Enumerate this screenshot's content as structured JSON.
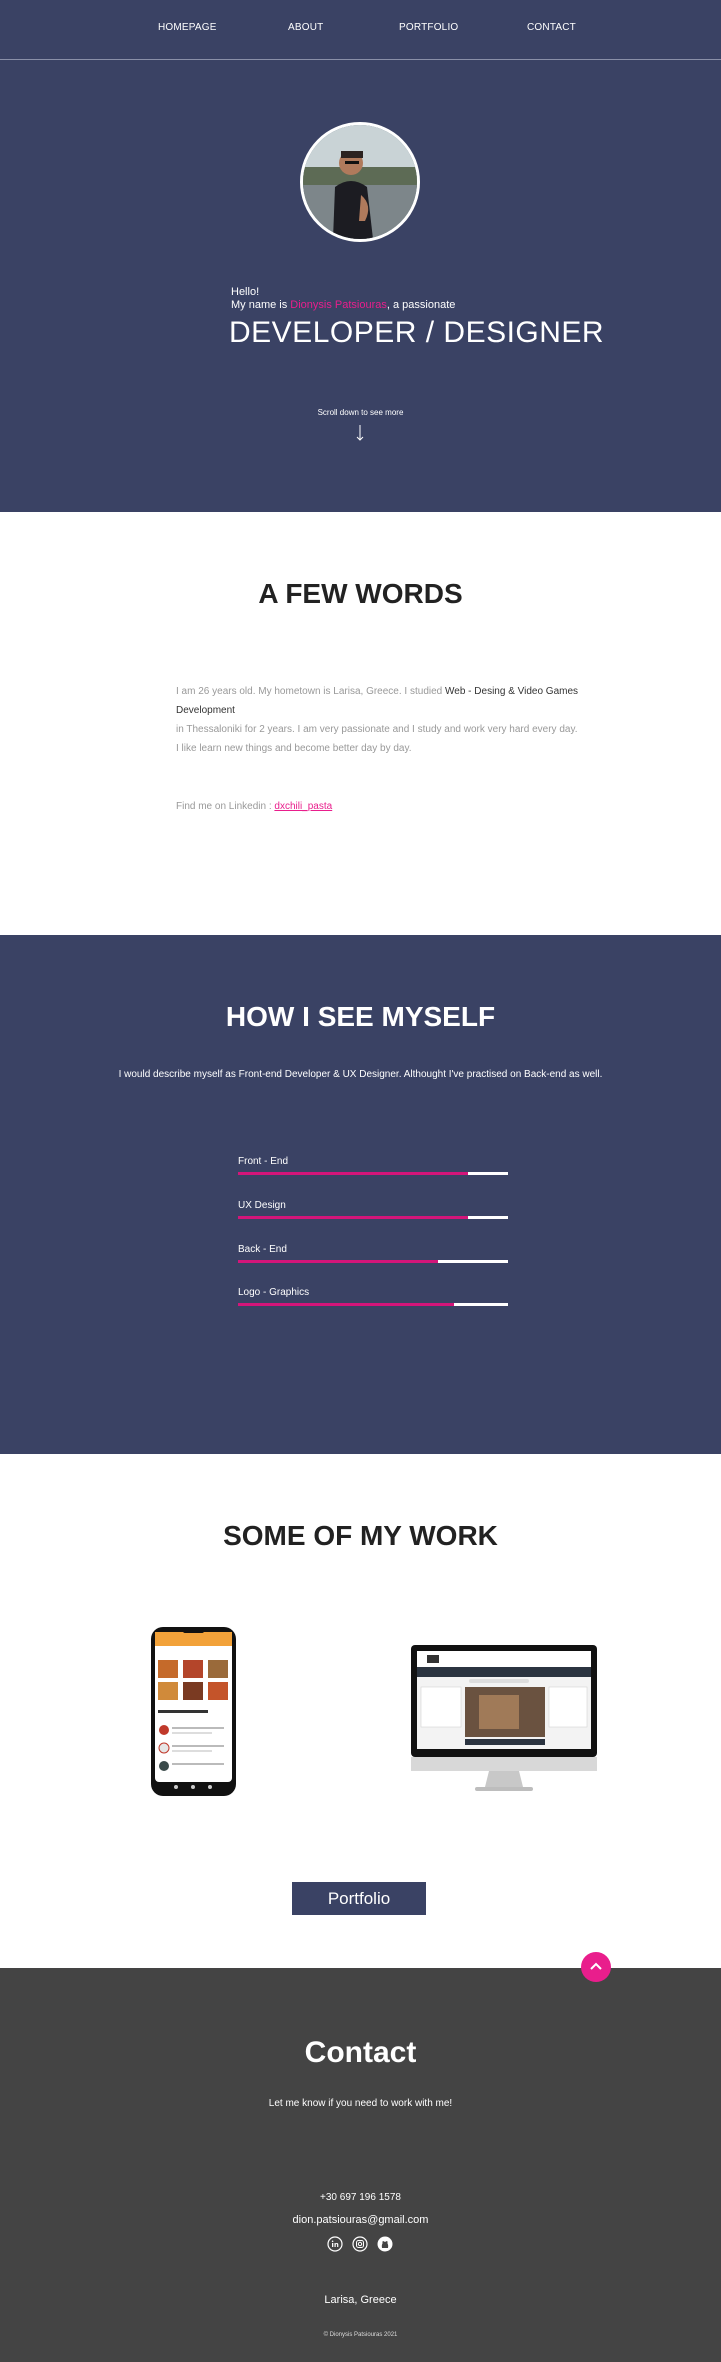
{
  "nav": {
    "items": [
      {
        "label": "HOMEPAGE"
      },
      {
        "label": "ABOUT"
      },
      {
        "label": "PORTFOLIO"
      },
      {
        "label": "CONTACT"
      }
    ]
  },
  "hero": {
    "hello": "Hello!",
    "name_prefix": "My name is ",
    "name": "Dionysis Patsiouras",
    "name_suffix": ", a passionate",
    "role": "DEVELOPER / DESIGNER",
    "scroll_hint": "Scroll down to see more"
  },
  "about": {
    "title": "A FEW WORDS",
    "line1_a": "I am 26 years old. My hometown is Larisa, Greece. I studied ",
    "line1_b": "Web - Desing & Video Games Development",
    "line2": "in Thessaloniki for 2 years. I am very passionate and I study and work very hard every day.",
    "line3": "I like learn new things and become better day by day.",
    "linkedin_label": "Find me on Linkedin : ",
    "linkedin_link": "dxchili_pasta"
  },
  "skills": {
    "title": "HOW I SEE MYSELF",
    "description": "I would describe myself as Front-end Developer & UX Designer. Althought I've practised on Back-end as well.",
    "items": [
      {
        "label": "Front - End",
        "level": 0.85
      },
      {
        "label": "UX Design",
        "level": 0.85
      },
      {
        "label": "Back - End",
        "level": 0.74
      },
      {
        "label": "Logo - Graphics",
        "level": 0.8
      }
    ],
    "fill_color": "#d4157a"
  },
  "work": {
    "title": "SOME OF MY WORK",
    "portfolio_button": "Portfolio"
  },
  "contact": {
    "title": "Contact",
    "subtitle": "Let me know if you need to work with me!",
    "phone": "+30 697 196 1578",
    "email": "dion.patsiouras@gmail.com",
    "socials": [
      "linkedin-icon",
      "instagram-icon",
      "github-icon"
    ],
    "location": "Larisa, Greece",
    "copyright": "© Dionysis Patsiouras 2021"
  },
  "colors": {
    "navy": "#3a4264",
    "accent": "#e91e8c",
    "footer": "#444444"
  }
}
